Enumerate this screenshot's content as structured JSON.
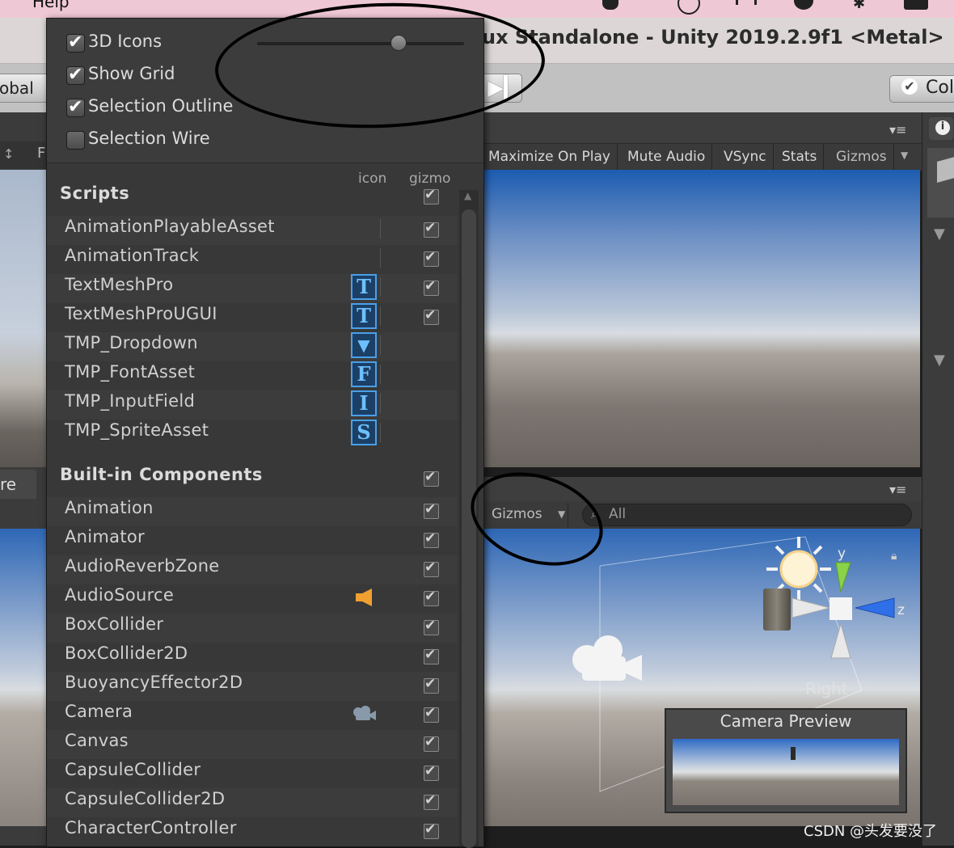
{
  "menubar": {
    "help_label": "Help"
  },
  "window": {
    "title": "ux Standalone - Unity 2019.2.9f1 <Metal>"
  },
  "toolbar": {
    "left_label": "obal",
    "collab_label": "Col"
  },
  "left_panel": {
    "tab_label": "re",
    "strip_letter": "F"
  },
  "gizmos_popup": {
    "toggles": [
      {
        "label": "3D Icons",
        "checked": true
      },
      {
        "label": "Show Grid",
        "checked": true
      },
      {
        "label": "Selection Outline",
        "checked": true
      },
      {
        "label": "Selection Wire",
        "checked": false
      }
    ],
    "column_icon": "icon",
    "column_gizmo": "gizmo",
    "scripts_header": "Scripts",
    "scripts": [
      {
        "name": "AnimationPlayableAsset",
        "icon": "",
        "gizmo": true
      },
      {
        "name": "AnimationTrack",
        "icon": "",
        "gizmo": true
      },
      {
        "name": "TextMeshPro",
        "icon": "T",
        "gizmo": true
      },
      {
        "name": "TextMeshProUGUI",
        "icon": "T",
        "gizmo": true
      },
      {
        "name": "TMP_Dropdown",
        "icon": "▼",
        "gizmo": false
      },
      {
        "name": "TMP_FontAsset",
        "icon": "F",
        "gizmo": false
      },
      {
        "name": "TMP_InputField",
        "icon": "I",
        "gizmo": false
      },
      {
        "name": "TMP_SpriteAsset",
        "icon": "S",
        "gizmo": false
      }
    ],
    "builtin_header": "Built-in Components",
    "builtin": [
      {
        "name": "Animation",
        "icon": "",
        "gizmo": true
      },
      {
        "name": "Animator",
        "icon": "",
        "gizmo": true
      },
      {
        "name": "AudioReverbZone",
        "icon": "",
        "gizmo": true
      },
      {
        "name": "AudioSource",
        "icon": "speaker-icon",
        "gizmo": true
      },
      {
        "name": "BoxCollider",
        "icon": "",
        "gizmo": true
      },
      {
        "name": "BoxCollider2D",
        "icon": "",
        "gizmo": true
      },
      {
        "name": "BuoyancyEffector2D",
        "icon": "",
        "gizmo": true
      },
      {
        "name": "Camera",
        "icon": "camera-icon",
        "gizmo": true
      },
      {
        "name": "Canvas",
        "icon": "",
        "gizmo": true
      },
      {
        "name": "CapsuleCollider",
        "icon": "",
        "gizmo": true
      },
      {
        "name": "CapsuleCollider2D",
        "icon": "",
        "gizmo": true
      },
      {
        "name": "CharacterController",
        "icon": "",
        "gizmo": true
      }
    ]
  },
  "game_view": {
    "buttons": [
      "Maximize On Play",
      "Mute Audio",
      "VSync",
      "Stats",
      "Gizmos"
    ]
  },
  "scene_view": {
    "gizmos_label": "Gizmos",
    "search_placeholder": "All",
    "axis_y": "y",
    "axis_z": "z",
    "orientation_label": "Right",
    "camera_preview_title": "Camera Preview"
  },
  "watermark": "CSDN @头发要没了",
  "colors": {
    "accent_blue": "#4aa0e8",
    "annotation": "#000000",
    "menubar_pink": "#efc8d5"
  }
}
